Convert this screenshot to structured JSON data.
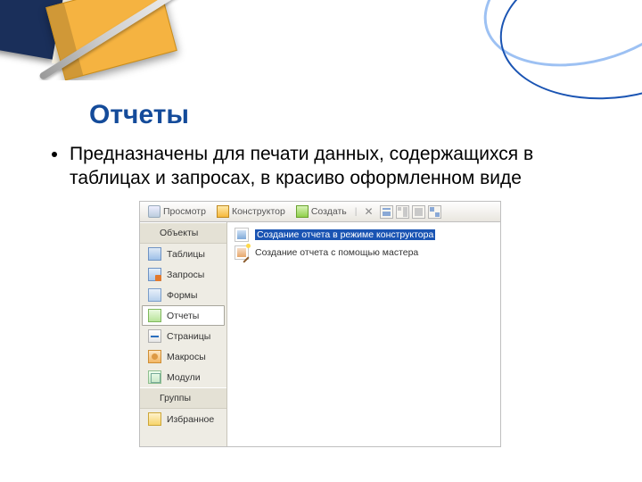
{
  "title": "Отчеты",
  "bullet": "Предназначены для печати данных, содержащихся в таблицах и запросах, в красиво оформленном виде",
  "toolbar": {
    "preview": "Просмотр",
    "designer": "Конструктор",
    "create": "Создать"
  },
  "sidebar": {
    "group1": "Объекты",
    "group2": "Группы",
    "items": [
      "Таблицы",
      "Запросы",
      "Формы",
      "Отчеты",
      "Страницы",
      "Макросы",
      "Модули",
      "Избранное"
    ]
  },
  "content": [
    "Создание отчета в режиме конструктора",
    "Создание отчета с помощью мастера"
  ]
}
